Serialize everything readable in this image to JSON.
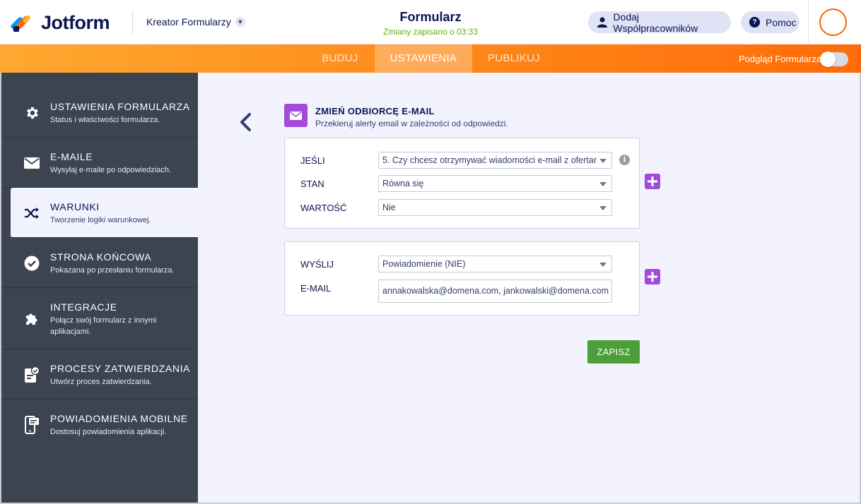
{
  "header": {
    "logo_text": "Jotform",
    "builder_dropdown": "Kreator Formularzy",
    "form_title": "Formularz",
    "save_status": "Zmiany zapisano o 03:33",
    "collaborators_label": "Dodaj Współpracowników",
    "help_label": "Pomoc"
  },
  "nav": {
    "tabs": [
      {
        "label": "BUDUJ"
      },
      {
        "label": "USTAWIENIA"
      },
      {
        "label": "PUBLIKUJ"
      }
    ],
    "active_tab": "USTAWIENIA",
    "preview_label": "Podgląd Formularza",
    "preview_enabled": false
  },
  "sidebar": {
    "items": [
      {
        "title": "USTAWIENIA FORMULARZA",
        "desc": "Status i właściwości formularza.",
        "icon": "gear-icon"
      },
      {
        "title": "E-MAILE",
        "desc": "Wysyłaj e-maile po odpowiedziach.",
        "icon": "envelope-icon"
      },
      {
        "title": "WARUNKI",
        "desc": "Tworzenie logiki warunkowej.",
        "icon": "shuffle-icon"
      },
      {
        "title": "STRONA KOŃCOWA",
        "desc": "Pokazana po przesłaniu formularza.",
        "icon": "check-circle-icon"
      },
      {
        "title": "INTEGRACJE",
        "desc": "Połącz swój formularz z innymi aplikacjami.",
        "icon": "puzzle-icon"
      },
      {
        "title": "PROCESY ZATWIERDZANIA",
        "desc": "Utwórz proces zatwierdzania.",
        "icon": "approval-icon"
      },
      {
        "title": "POWIADOMIENIA MOBILNE",
        "desc": "Dostosuj powiadomienia aplikacji.",
        "icon": "mobile-notification-icon"
      }
    ],
    "active_index": 2
  },
  "condition": {
    "title": "ZMIEŃ ODBIORCĘ E-MAIL",
    "subtitle": "Przekieruj alerty email w zależności od odpowiedzi.",
    "if_label": "JEŚLI",
    "if_value": "5. Czy chcesz otrzymywać wiadomości e-mail z ofertar",
    "state_label": "STAN",
    "state_value": "Równa się",
    "value_label": "WARTOŚĆ",
    "value_value": "Nie",
    "send_label": "WYŚLIJ",
    "send_value": "Powiadomienie (NIE)",
    "email_label": "E-MAIL",
    "email_value": "annakowalska@domena.com, jankowalski@domena.com",
    "save_label": "ZAPISZ"
  },
  "colors": {
    "accent_orange": "#ff6100",
    "purple": "#a24bda",
    "save_green": "#4c9f38",
    "sidebar_bg": "#3c4351"
  }
}
